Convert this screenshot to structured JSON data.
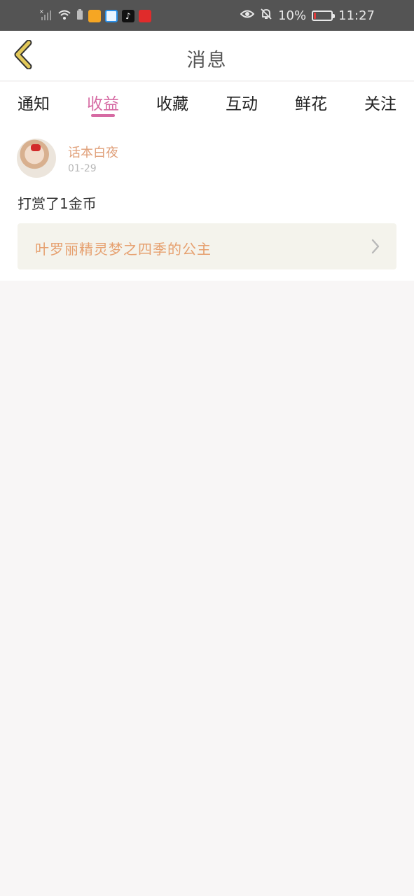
{
  "status_bar": {
    "battery_percent_label": "10%",
    "battery_level": 0.1,
    "time": "11:27",
    "icons": [
      "signal-off-icon",
      "wifi-icon",
      "battery-saver-icon",
      "weibo-app-icon",
      "browser-app-icon",
      "tiktok-app-icon",
      "red-app-icon",
      "eye-comfort-icon",
      "mute-icon",
      "battery-icon"
    ],
    "colors": {
      "background": "#545454",
      "battery_low": "#e23a3a"
    }
  },
  "header": {
    "title": "消息",
    "back_icon": "chevron-left-icon",
    "back_icon_color": "#e3c95a"
  },
  "tabs": [
    {
      "label": "通知",
      "active": false
    },
    {
      "label": "收益",
      "active": true
    },
    {
      "label": "收藏",
      "active": false
    },
    {
      "label": "互动",
      "active": false
    },
    {
      "label": "鲜花",
      "active": false
    },
    {
      "label": "关注",
      "active": false
    }
  ],
  "accent_color": "#d66aa3",
  "message": {
    "user_name": "话本白夜",
    "date": "01-29",
    "text": "打赏了1金币",
    "book": {
      "title": "叶罗丽精灵梦之四季的公主",
      "icon": "chevron-right-icon"
    }
  }
}
